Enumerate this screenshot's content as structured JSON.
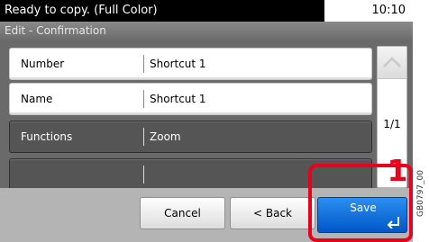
{
  "status": {
    "message": "Ready to copy. (Full Color)",
    "time": "10:10"
  },
  "title": "Edit - Confirmation",
  "fields": [
    {
      "label": "Number",
      "value": "Shortcut 1"
    },
    {
      "label": "Name",
      "value": "Shortcut 1"
    },
    {
      "label": "Functions",
      "value": "Zoom"
    },
    {
      "label": "",
      "value": ""
    }
  ],
  "pagination": {
    "page": "1/1"
  },
  "buttons": {
    "cancel": "Cancel",
    "back": "< Back",
    "save": "Save"
  },
  "callout": {
    "number": "1"
  },
  "figure_code": "GB0797_00",
  "colors": {
    "highlight": "#e8001c",
    "save_button": "#0a6fe0"
  },
  "icons": [
    "chevron-up-icon",
    "enter-icon"
  ]
}
